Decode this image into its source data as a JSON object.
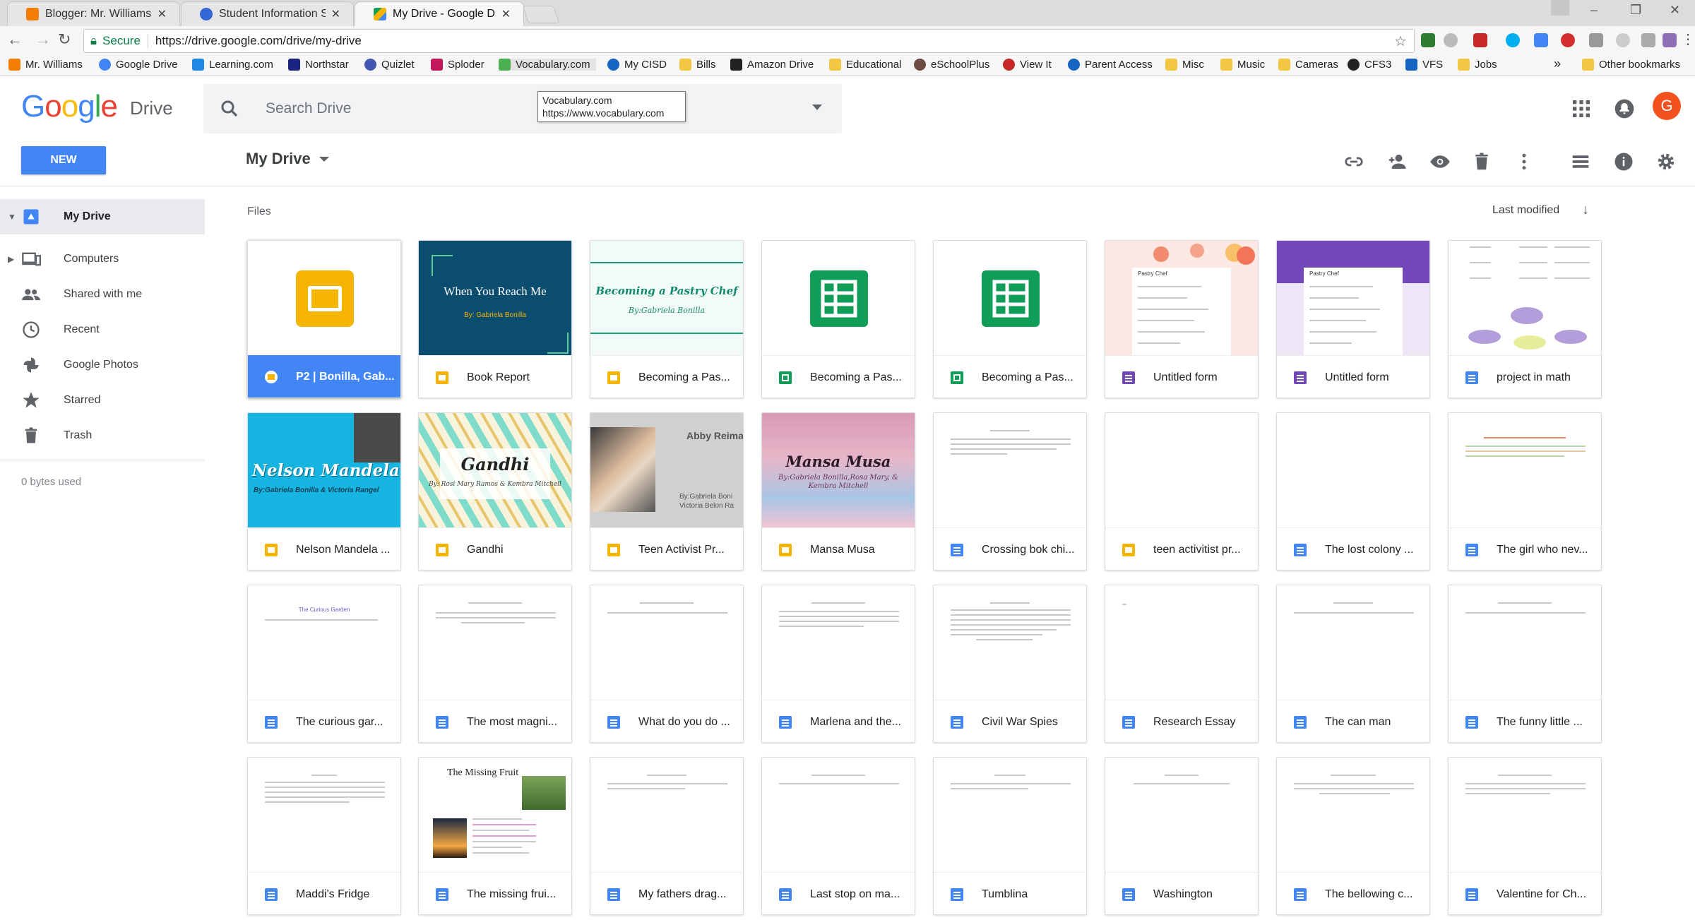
{
  "browser": {
    "tabs": [
      {
        "title": "Blogger: Mr. Williams' Cl",
        "icon_color": "#f57d00"
      },
      {
        "title": "Student Information Syst",
        "icon_color": "#3367d6"
      },
      {
        "title": "My Drive - Google Drive",
        "icon_color": "#0f9d58"
      }
    ],
    "security_label": "Secure",
    "url": "https://drive.google.com/drive/my-drive",
    "bookmarks": [
      {
        "label": "Mr. Williams",
        "icon": "blogger-icon",
        "color": "#f57d00"
      },
      {
        "label": "Google Drive",
        "icon": "google-icon",
        "color": "#4285f4"
      },
      {
        "label": "Learning.com",
        "icon": "learning-icon",
        "color": "#1e88e5"
      },
      {
        "label": "Northstar",
        "icon": "northstar-icon",
        "color": "#1a237e"
      },
      {
        "label": "Quizlet",
        "icon": "quizlet-icon",
        "color": "#4257b2"
      },
      {
        "label": "Sploder",
        "icon": "sploder-icon",
        "color": "#c2185b"
      },
      {
        "label": "Vocabulary.com",
        "icon": "vocabulary-icon",
        "color": "#4caf50"
      },
      {
        "label": "My CISD",
        "icon": "cisd-icon",
        "color": "#1565c0"
      },
      {
        "label": "Bills",
        "icon": "folder-icon",
        "color": "#f2c744"
      },
      {
        "label": "Amazon Drive",
        "icon": "amazon-icon",
        "color": "#222222"
      },
      {
        "label": "Educational",
        "icon": "folder-icon",
        "color": "#f2c744"
      },
      {
        "label": "eSchoolPlus",
        "icon": "eschool-icon",
        "color": "#6d4c41"
      },
      {
        "label": "View It",
        "icon": "viewit-icon",
        "color": "#c62828"
      },
      {
        "label": "Parent Access",
        "icon": "parent-icon",
        "color": "#1565c0"
      },
      {
        "label": "Misc",
        "icon": "folder-icon",
        "color": "#f2c744"
      },
      {
        "label": "Music",
        "icon": "folder-icon",
        "color": "#f2c744"
      },
      {
        "label": "Cameras",
        "icon": "folder-icon",
        "color": "#f2c744"
      },
      {
        "label": "CFS3",
        "icon": "soccer-icon",
        "color": "#222222"
      },
      {
        "label": "VFS",
        "icon": "vfs-icon",
        "color": "#1565c0"
      },
      {
        "label": "Jobs",
        "icon": "folder-icon",
        "color": "#f2c744"
      }
    ],
    "overflow_label": "»",
    "other_bookmarks": "Other bookmarks",
    "link_tooltip": {
      "title": "Vocabulary.com",
      "url": "https://www.vocabulary.com"
    }
  },
  "drive": {
    "logo": "Google",
    "product": "Drive",
    "search_placeholder": "Search Drive",
    "avatar_letter": "G",
    "new_label": "NEW",
    "breadcrumb": "My Drive",
    "sidebar": [
      {
        "label": "My Drive",
        "icon": "my-drive-icon"
      },
      {
        "label": "Computers",
        "icon": "computers-icon"
      },
      {
        "label": "Shared with me",
        "icon": "shared-icon"
      },
      {
        "label": "Recent",
        "icon": "clock-icon"
      },
      {
        "label": "Google Photos",
        "icon": "photos-icon"
      },
      {
        "label": "Starred",
        "icon": "star-icon"
      },
      {
        "label": "Trash",
        "icon": "trash-icon"
      }
    ],
    "storage": "0 bytes used",
    "files_label": "Files",
    "sort_label": "Last modified",
    "colors": {
      "accent": "#4285f4",
      "docs": "#4285f4",
      "slides": "#f4b400",
      "sheets": "#0f9d58",
      "forms": "#7248b9"
    },
    "files": [
      {
        "name": "P2 | Bonilla, Gab...",
        "type": "slide"
      },
      {
        "name": "Book Report",
        "type": "slide"
      },
      {
        "name": "Becoming a Pas...",
        "type": "slide"
      },
      {
        "name": "Becoming a Pas...",
        "type": "sheet"
      },
      {
        "name": "Becoming a Pas...",
        "type": "sheet"
      },
      {
        "name": "Untitled form",
        "type": "form"
      },
      {
        "name": "Untitled form",
        "type": "form"
      },
      {
        "name": "project in math",
        "type": "doc"
      },
      {
        "name": "Nelson Mandela ...",
        "type": "slide"
      },
      {
        "name": "Gandhi",
        "type": "slide"
      },
      {
        "name": "Teen Activist Pr...",
        "type": "slide"
      },
      {
        "name": "Mansa Musa",
        "type": "slide"
      },
      {
        "name": "Crossing bok chi...",
        "type": "doc"
      },
      {
        "name": "teen activitist pr...",
        "type": "slide"
      },
      {
        "name": "The lost colony ...",
        "type": "doc"
      },
      {
        "name": "The girl who nev...",
        "type": "doc"
      },
      {
        "name": "The curious gar...",
        "type": "doc"
      },
      {
        "name": "The most magni...",
        "type": "doc"
      },
      {
        "name": "What do you do ...",
        "type": "doc"
      },
      {
        "name": "Marlena and the...",
        "type": "doc"
      },
      {
        "name": "Civil War Spies",
        "type": "doc"
      },
      {
        "name": "Research Essay",
        "type": "doc"
      },
      {
        "name": "The can man",
        "type": "doc"
      },
      {
        "name": "The funny little ...",
        "type": "doc"
      },
      {
        "name": "Maddi's Fridge",
        "type": "doc"
      },
      {
        "name": "The missing frui...",
        "type": "doc"
      },
      {
        "name": "My fathers drag...",
        "type": "doc"
      },
      {
        "name": "Last stop on ma...",
        "type": "doc"
      },
      {
        "name": "Tumblina",
        "type": "doc"
      },
      {
        "name": "Washington",
        "type": "doc"
      },
      {
        "name": "The bellowing c...",
        "type": "doc"
      },
      {
        "name": "Valentine for Ch...",
        "type": "doc"
      }
    ],
    "thumbnails": {
      "book_report_title": "When You Reach Me",
      "book_report_author": "By: Gabriela Bonilla",
      "pastry_title": "Becoming a Pastry Chef",
      "pastry_author": "By:Gabriela Bonilla",
      "form_title": "Pastry Chef",
      "mandela_title": "Nelson Mandela",
      "mandela_author": "By:Gabriela Bonilla & Victoria Rangel",
      "gandhi_title": "Gandhi",
      "gandhi_author": "By: Rosi Mary Ramos & Kembra Mitchell",
      "teen_title": "Abby Reima",
      "teen_author": "By:Gabriela Boni Victoria Belon Ra",
      "mansa_title": "Mansa Musa",
      "mansa_author": "By:Gabriela Bonilla,Rosa Mary, & Kembra Mitchell",
      "curious_title": "The Curious Garden",
      "missing_title": "The Missing Fruit"
    }
  }
}
